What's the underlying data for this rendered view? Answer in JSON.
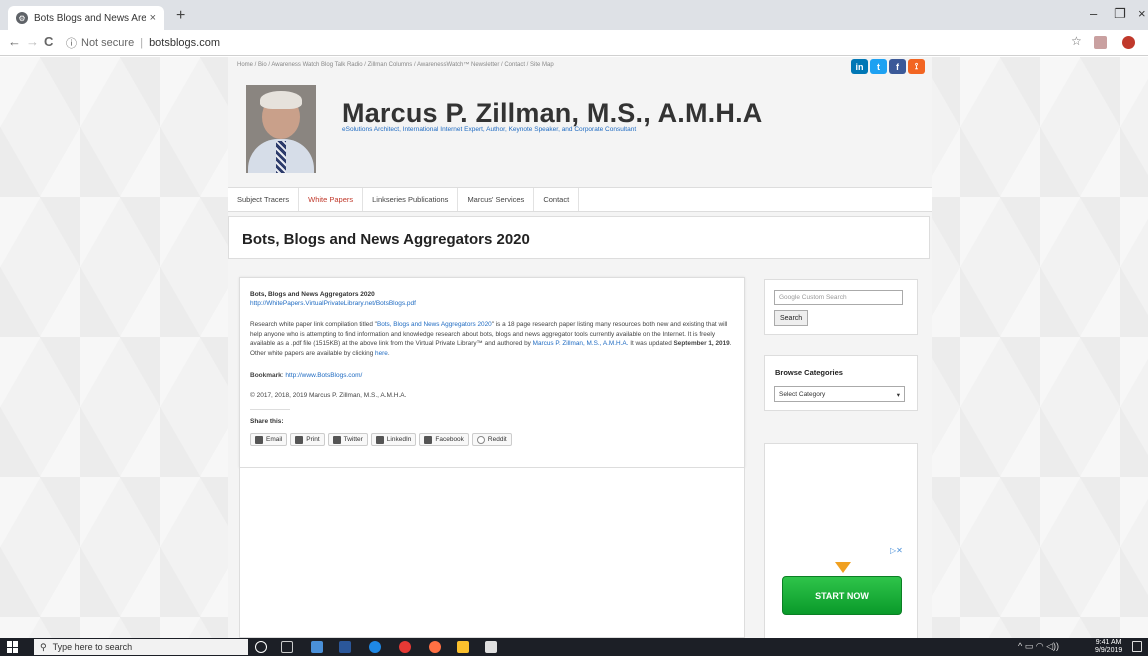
{
  "browser": {
    "tab_title": "Bots Blogs and News Aregators",
    "tab_close": "×",
    "new_tab": "+",
    "back": "←",
    "forward": "→",
    "reload": "C",
    "info_icon": "ⓘ",
    "not_secure": "Not secure",
    "url": "botsblogs.com",
    "star": "☆",
    "minimize": "–",
    "restore": "❐",
    "close": "×"
  },
  "topnav": {
    "text": "Home  /  Bio  /  Awareness Watch Blog Talk Radio  /  Zillman Columns  /  AwarenessWatch™ Newsletter  /  Contact  /  Site Map"
  },
  "social": {
    "linkedin": "in",
    "twitter": "t",
    "facebook": "f",
    "rss": "⟟"
  },
  "header": {
    "site_name": "Marcus P. Zillman, M.S., A.M.H.A",
    "tagline": "eSolutions Architect, International Internet Expert, Author, Keynote Speaker, and Corporate Consultant"
  },
  "mainnav": {
    "items": [
      "Subject Tracers",
      "White Papers",
      "Linkseries Publications",
      "Marcus' Services",
      "Contact"
    ]
  },
  "page": {
    "title": "Bots, Blogs and News Aggregators 2020"
  },
  "article": {
    "heading": "Bots, Blogs and News Aggregators 2020",
    "pdf_link": "http://WhitePapers.VirtualPrivateLibrary.net/BotsBlogs.pdf",
    "para_1": "Research white paper link compilation titled \"",
    "para_title_link": "Bots, Blogs and News Aggregators 2020",
    "para_2": "\" is a 18 page research paper listing many resources both new and existing that will help  anyone who is attempting to find information and knowledge research about bots, blogs and news aggregator tools currently available on the Internet. It is  freely available as a .pdf file (1515KB) at the above link from the Virtual  Private Library™ and authored by ",
    "para_author_link": "Marcus P. Zillman, M.S., A.M.H.A.",
    "para_3": " It was updated ",
    "para_date": "September 1, 2019",
    "para_4": ". Other  white papers are available by clicking ",
    "para_here": "here",
    "para_5": ".",
    "bookmark_label": "Bookmark",
    "bookmark_url": "http://www.BotsBlogs.com/",
    "copyright": "© 2017, 2018, 2019 Marcus P. Zillman, M.S., A.M.H.A.",
    "share_label": "Share this:",
    "share_buttons": [
      "Email",
      "Print",
      "Twitter",
      "LinkedIn",
      "Facebook",
      "Reddit"
    ]
  },
  "sidebar": {
    "search_placeholder": "Google  Custom Search",
    "search_button": "Search",
    "browse_heading": "Browse Categories",
    "category_select": "Select Category",
    "select_arrow": "▾",
    "ad_close": "▷✕",
    "ad_button": "START NOW"
  },
  "taskbar": {
    "search_placeholder": "Type here to search",
    "search_icon": "⚲",
    "tray_icons": "^  ▭  ◠  ◁))",
    "time": "9:41 AM",
    "date": "9/9/2019"
  },
  "colors": {
    "link_blue": "#1f6bc2",
    "nav_active": "#c0392b",
    "linkedin": "#0077b5",
    "twitter": "#1da1f2",
    "facebook": "#3b5998",
    "rss": "#f26522",
    "ad_green": "#14a832"
  }
}
